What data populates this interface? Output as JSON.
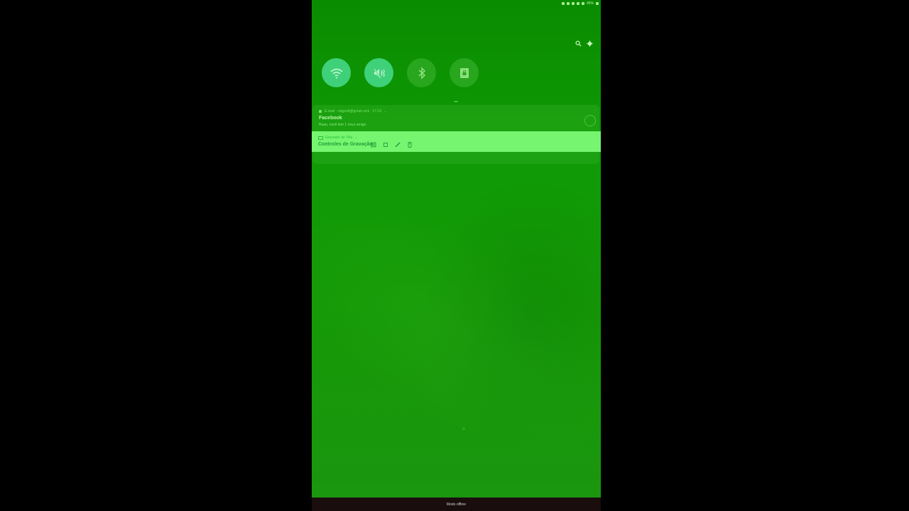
{
  "status_bar": {
    "battery": "45%",
    "icons": [
      "bluetooth-icon",
      "vibrate-icon",
      "mute-icon",
      "wifi-icon",
      "signal-icon",
      "battery-icon"
    ]
  },
  "header": {
    "icons": [
      "search-icon",
      "settings-gear-icon"
    ]
  },
  "quick_toggles": [
    {
      "name": "wifi",
      "icon": "wifi-icon",
      "state": "on"
    },
    {
      "name": "sound",
      "icon": "mute-vibrate-icon",
      "state": "on"
    },
    {
      "name": "bluetooth",
      "icon": "bluetooth-icon",
      "state": "off"
    },
    {
      "name": "screen-lock",
      "icon": "lock-rotation-icon",
      "state": "off"
    }
  ],
  "notifications": {
    "mail": {
      "app": "E-mail",
      "account": "cidgeolt@gmail.com",
      "time": "17:13",
      "title": "Facebook",
      "body": "Ruan, você tem 1 novo amigo"
    },
    "recorder": {
      "app": "Gravador de Tela",
      "title": "Controles de Gravação",
      "controls": [
        "pause-icon",
        "stop-icon",
        "draw-pen-icon",
        "camera-icon"
      ]
    }
  },
  "bottom_bar": {
    "label": "Modo offline"
  },
  "colors": {
    "toggle_on": "#3fd07a",
    "toggle_off": "#28a61d",
    "recorder_bar": "#76f570",
    "bottom_bar": "#1a0d0d"
  }
}
